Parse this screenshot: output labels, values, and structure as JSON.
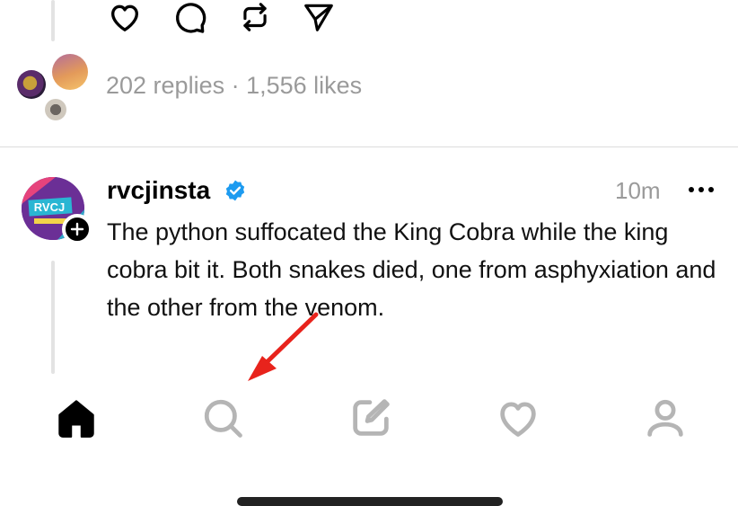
{
  "previous_post": {
    "actions": [
      {
        "name": "like",
        "icon": "heart-icon"
      },
      {
        "name": "reply",
        "icon": "comment-bubble-icon"
      },
      {
        "name": "repost",
        "icon": "repost-icon"
      },
      {
        "name": "share",
        "icon": "send-icon"
      }
    ],
    "replies_text": "202 replies",
    "separator": " · ",
    "likes_text": "1,556 likes"
  },
  "post": {
    "username": "rvcjinsta",
    "verified": true,
    "time": "10m",
    "avatar_text": "RVCJ",
    "text": "The python suffocated the King Cobra while the king cobra bit it. Both snakes died, one from asphyxiation and the other from the venom."
  },
  "bottom_nav": [
    {
      "name": "home",
      "icon": "home-icon",
      "active": true
    },
    {
      "name": "search",
      "icon": "search-icon",
      "active": false
    },
    {
      "name": "compose",
      "icon": "compose-icon",
      "active": false
    },
    {
      "name": "activity",
      "icon": "heart-icon",
      "active": false
    },
    {
      "name": "profile",
      "icon": "profile-icon",
      "active": false
    }
  ],
  "colors": {
    "verified": "#1d9bf0",
    "annotation_arrow": "#e8231c",
    "inactive_icon": "#b5b5b5",
    "meta_text": "#9a9a9a"
  }
}
